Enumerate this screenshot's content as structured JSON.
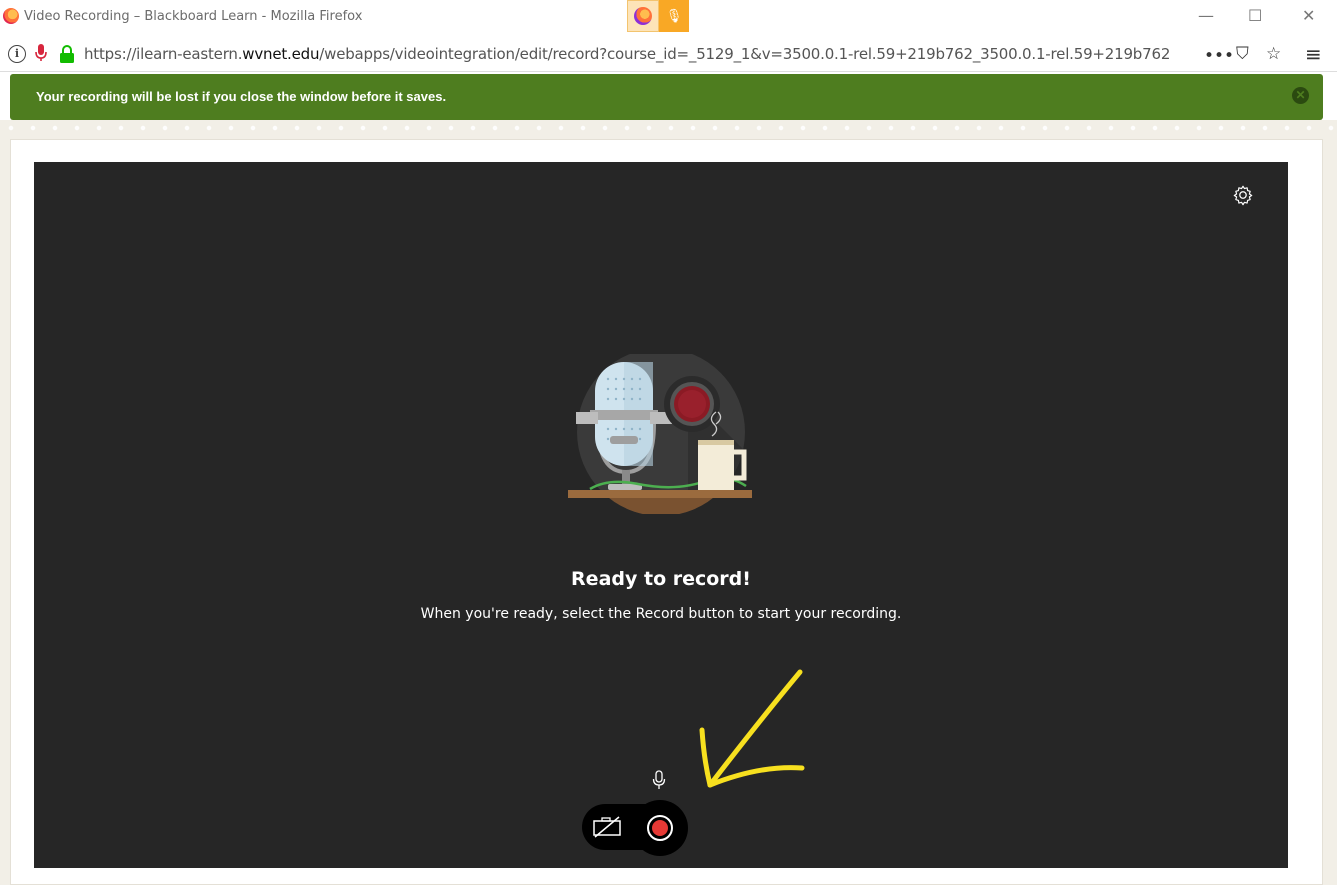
{
  "window": {
    "title": "Video Recording – Blackboard Learn - Mozilla Firefox",
    "controls": {
      "minimize": "—",
      "maximize": "☐",
      "close": "✕"
    }
  },
  "urlbar": {
    "url_prefix": "https://ilearn-eastern.",
    "url_domain": "wvnet.edu",
    "url_path": "/webapps/videointegration/edit/record?course_id=_5129_1&v=3500.0.1-rel.59+219b762_3500.0.1-rel.59+219b762",
    "more": "•••",
    "pocket": "⛉",
    "bookmark": "☆",
    "menu": "≡"
  },
  "notice": {
    "message": "Your recording will be lost if you close the window before it saves.",
    "close": "✕"
  },
  "recorder": {
    "title": "Ready to record!",
    "subtitle": "When you're ready, select the Record button to start your recording."
  },
  "colors": {
    "notice_bg": "#4e7d1f",
    "recorder_bg": "#262626",
    "record_dot": "#e53935",
    "annotation_arrow": "#f7e01f"
  },
  "icons": [
    "firefox-icon",
    "info-icon",
    "microphone-icon",
    "lock-icon",
    "gear-icon",
    "camera-off-icon",
    "record-icon"
  ]
}
